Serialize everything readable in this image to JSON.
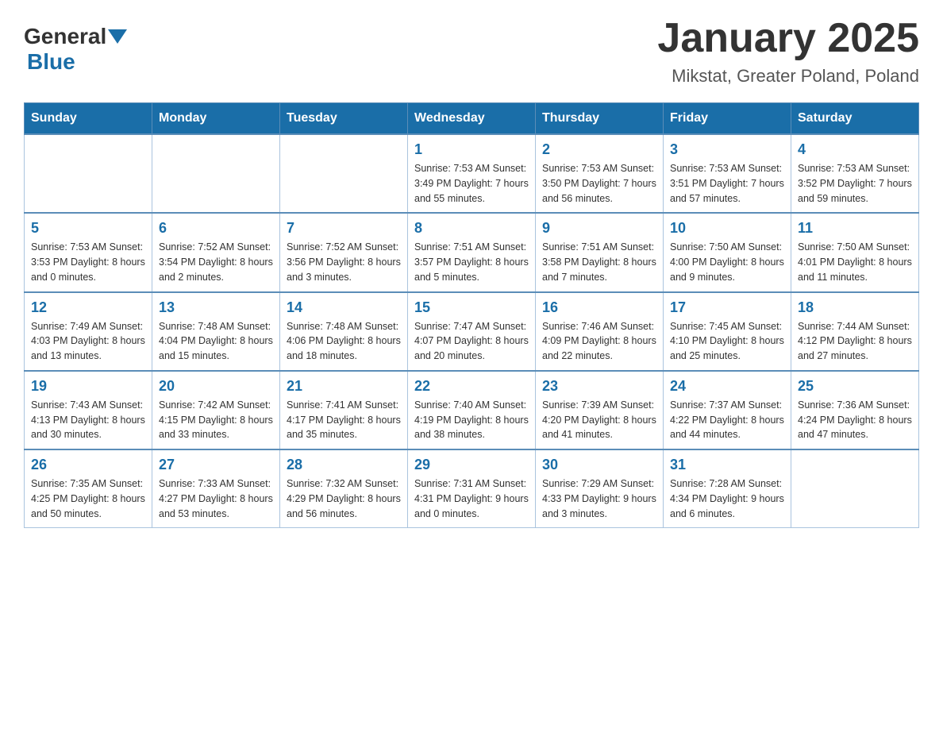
{
  "header": {
    "logo_general": "General",
    "logo_blue": "Blue",
    "title": "January 2025",
    "subtitle": "Mikstat, Greater Poland, Poland"
  },
  "calendar": {
    "days_of_week": [
      "Sunday",
      "Monday",
      "Tuesday",
      "Wednesday",
      "Thursday",
      "Friday",
      "Saturday"
    ],
    "weeks": [
      [
        {
          "day": "",
          "info": ""
        },
        {
          "day": "",
          "info": ""
        },
        {
          "day": "",
          "info": ""
        },
        {
          "day": "1",
          "info": "Sunrise: 7:53 AM\nSunset: 3:49 PM\nDaylight: 7 hours and 55 minutes."
        },
        {
          "day": "2",
          "info": "Sunrise: 7:53 AM\nSunset: 3:50 PM\nDaylight: 7 hours and 56 minutes."
        },
        {
          "day": "3",
          "info": "Sunrise: 7:53 AM\nSunset: 3:51 PM\nDaylight: 7 hours and 57 minutes."
        },
        {
          "day": "4",
          "info": "Sunrise: 7:53 AM\nSunset: 3:52 PM\nDaylight: 7 hours and 59 minutes."
        }
      ],
      [
        {
          "day": "5",
          "info": "Sunrise: 7:53 AM\nSunset: 3:53 PM\nDaylight: 8 hours and 0 minutes."
        },
        {
          "day": "6",
          "info": "Sunrise: 7:52 AM\nSunset: 3:54 PM\nDaylight: 8 hours and 2 minutes."
        },
        {
          "day": "7",
          "info": "Sunrise: 7:52 AM\nSunset: 3:56 PM\nDaylight: 8 hours and 3 minutes."
        },
        {
          "day": "8",
          "info": "Sunrise: 7:51 AM\nSunset: 3:57 PM\nDaylight: 8 hours and 5 minutes."
        },
        {
          "day": "9",
          "info": "Sunrise: 7:51 AM\nSunset: 3:58 PM\nDaylight: 8 hours and 7 minutes."
        },
        {
          "day": "10",
          "info": "Sunrise: 7:50 AM\nSunset: 4:00 PM\nDaylight: 8 hours and 9 minutes."
        },
        {
          "day": "11",
          "info": "Sunrise: 7:50 AM\nSunset: 4:01 PM\nDaylight: 8 hours and 11 minutes."
        }
      ],
      [
        {
          "day": "12",
          "info": "Sunrise: 7:49 AM\nSunset: 4:03 PM\nDaylight: 8 hours and 13 minutes."
        },
        {
          "day": "13",
          "info": "Sunrise: 7:48 AM\nSunset: 4:04 PM\nDaylight: 8 hours and 15 minutes."
        },
        {
          "day": "14",
          "info": "Sunrise: 7:48 AM\nSunset: 4:06 PM\nDaylight: 8 hours and 18 minutes."
        },
        {
          "day": "15",
          "info": "Sunrise: 7:47 AM\nSunset: 4:07 PM\nDaylight: 8 hours and 20 minutes."
        },
        {
          "day": "16",
          "info": "Sunrise: 7:46 AM\nSunset: 4:09 PM\nDaylight: 8 hours and 22 minutes."
        },
        {
          "day": "17",
          "info": "Sunrise: 7:45 AM\nSunset: 4:10 PM\nDaylight: 8 hours and 25 minutes."
        },
        {
          "day": "18",
          "info": "Sunrise: 7:44 AM\nSunset: 4:12 PM\nDaylight: 8 hours and 27 minutes."
        }
      ],
      [
        {
          "day": "19",
          "info": "Sunrise: 7:43 AM\nSunset: 4:13 PM\nDaylight: 8 hours and 30 minutes."
        },
        {
          "day": "20",
          "info": "Sunrise: 7:42 AM\nSunset: 4:15 PM\nDaylight: 8 hours and 33 minutes."
        },
        {
          "day": "21",
          "info": "Sunrise: 7:41 AM\nSunset: 4:17 PM\nDaylight: 8 hours and 35 minutes."
        },
        {
          "day": "22",
          "info": "Sunrise: 7:40 AM\nSunset: 4:19 PM\nDaylight: 8 hours and 38 minutes."
        },
        {
          "day": "23",
          "info": "Sunrise: 7:39 AM\nSunset: 4:20 PM\nDaylight: 8 hours and 41 minutes."
        },
        {
          "day": "24",
          "info": "Sunrise: 7:37 AM\nSunset: 4:22 PM\nDaylight: 8 hours and 44 minutes."
        },
        {
          "day": "25",
          "info": "Sunrise: 7:36 AM\nSunset: 4:24 PM\nDaylight: 8 hours and 47 minutes."
        }
      ],
      [
        {
          "day": "26",
          "info": "Sunrise: 7:35 AM\nSunset: 4:25 PM\nDaylight: 8 hours and 50 minutes."
        },
        {
          "day": "27",
          "info": "Sunrise: 7:33 AM\nSunset: 4:27 PM\nDaylight: 8 hours and 53 minutes."
        },
        {
          "day": "28",
          "info": "Sunrise: 7:32 AM\nSunset: 4:29 PM\nDaylight: 8 hours and 56 minutes."
        },
        {
          "day": "29",
          "info": "Sunrise: 7:31 AM\nSunset: 4:31 PM\nDaylight: 9 hours and 0 minutes."
        },
        {
          "day": "30",
          "info": "Sunrise: 7:29 AM\nSunset: 4:33 PM\nDaylight: 9 hours and 3 minutes."
        },
        {
          "day": "31",
          "info": "Sunrise: 7:28 AM\nSunset: 4:34 PM\nDaylight: 9 hours and 6 minutes."
        },
        {
          "day": "",
          "info": ""
        }
      ]
    ]
  }
}
